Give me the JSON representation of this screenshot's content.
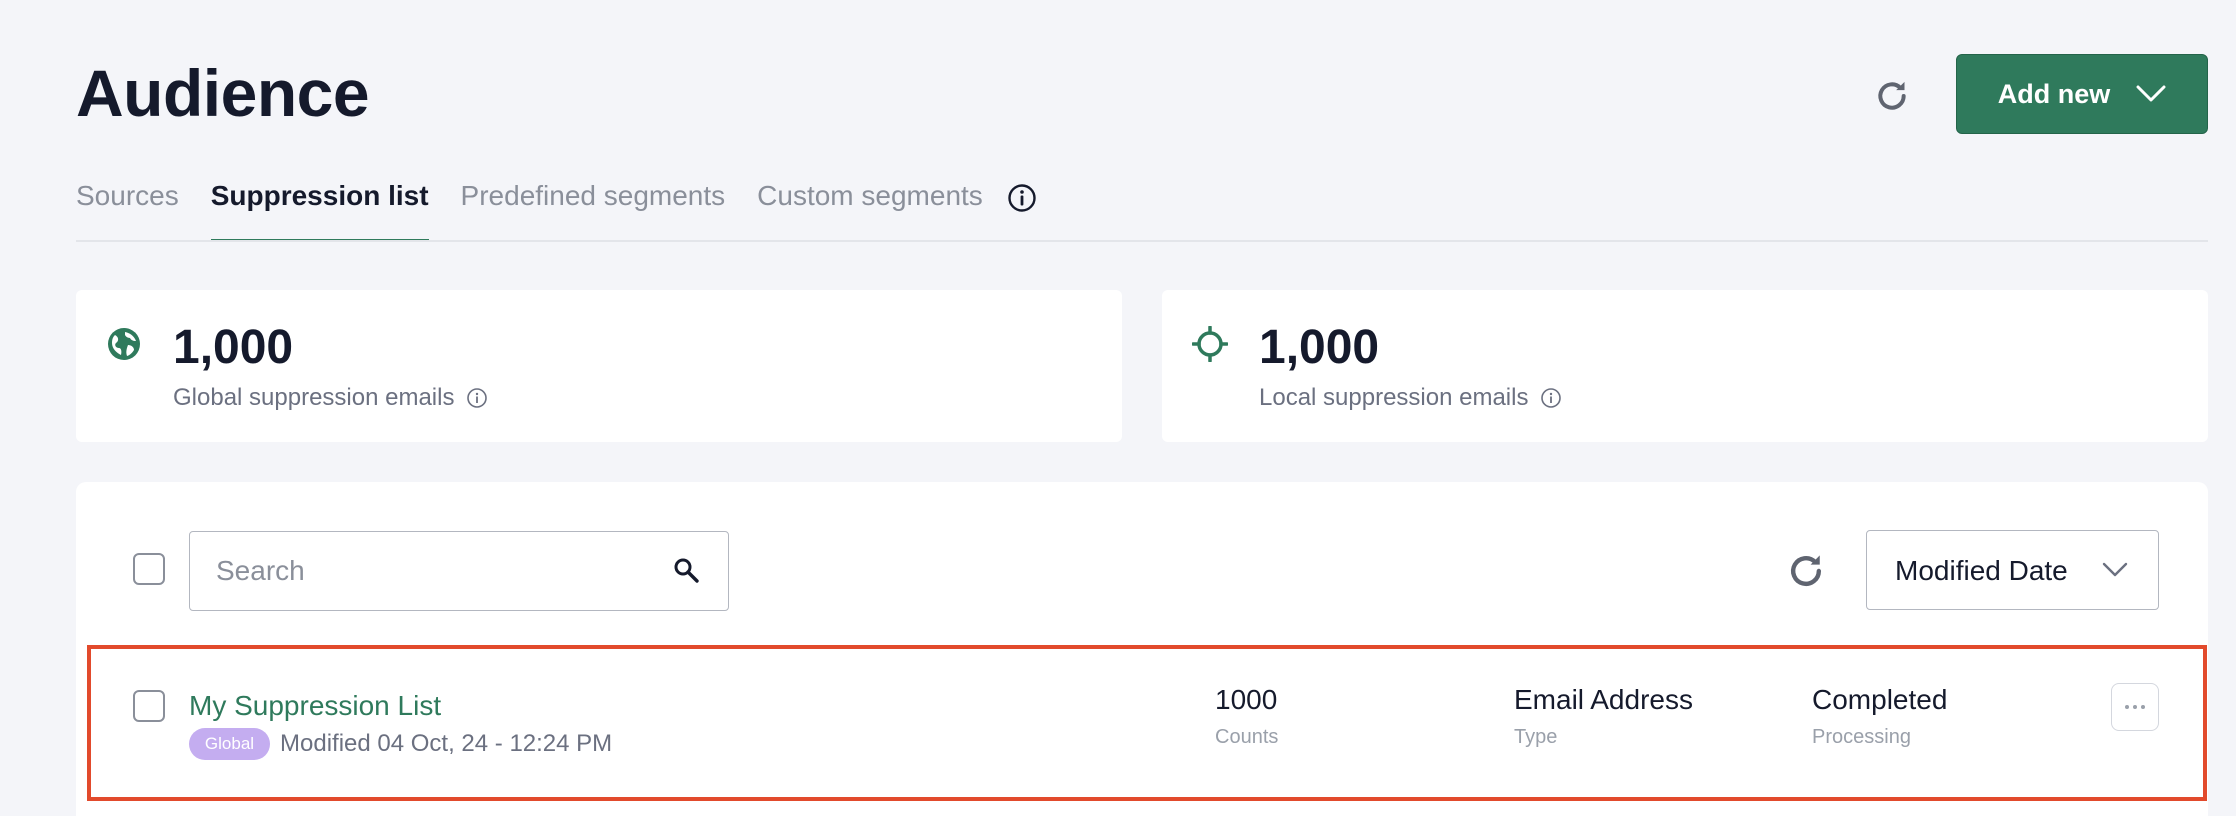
{
  "header": {
    "title": "Audience",
    "refresh_icon": "refresh-icon",
    "add_new_label": "Add new",
    "add_new_icon": "chevron-down-icon"
  },
  "tabs": [
    {
      "label": "Sources",
      "active": false
    },
    {
      "label": "Suppression list",
      "active": true
    },
    {
      "label": "Predefined segments",
      "active": false
    },
    {
      "label": "Custom segments",
      "active": false
    }
  ],
  "tabs_info_icon": "info-icon",
  "stats": {
    "global": {
      "icon": "globe-icon",
      "value": "1,000",
      "label": "Global suppression emails",
      "info_icon": "info-icon"
    },
    "local": {
      "icon": "crosshair-icon",
      "value": "1,000",
      "label": "Local suppression emails",
      "info_icon": "info-icon"
    }
  },
  "list_toolbar": {
    "search_placeholder": "Search",
    "search_value": "",
    "sort_selected": "Modified Date"
  },
  "rows": [
    {
      "name": "My Suppression List",
      "badge": "Global",
      "modified": "Modified 04 Oct, 24 - 12:24 PM",
      "counts_value": "1000",
      "counts_label": "Counts",
      "type_value": "Email Address",
      "type_label": "Type",
      "processing_value": "Completed",
      "processing_label": "Processing",
      "highlighted": true
    }
  ],
  "colors": {
    "accent": "#2f7a5c",
    "badge": "#c4adf0",
    "highlight": "#e24a2c",
    "background": "#f4f5f9"
  }
}
